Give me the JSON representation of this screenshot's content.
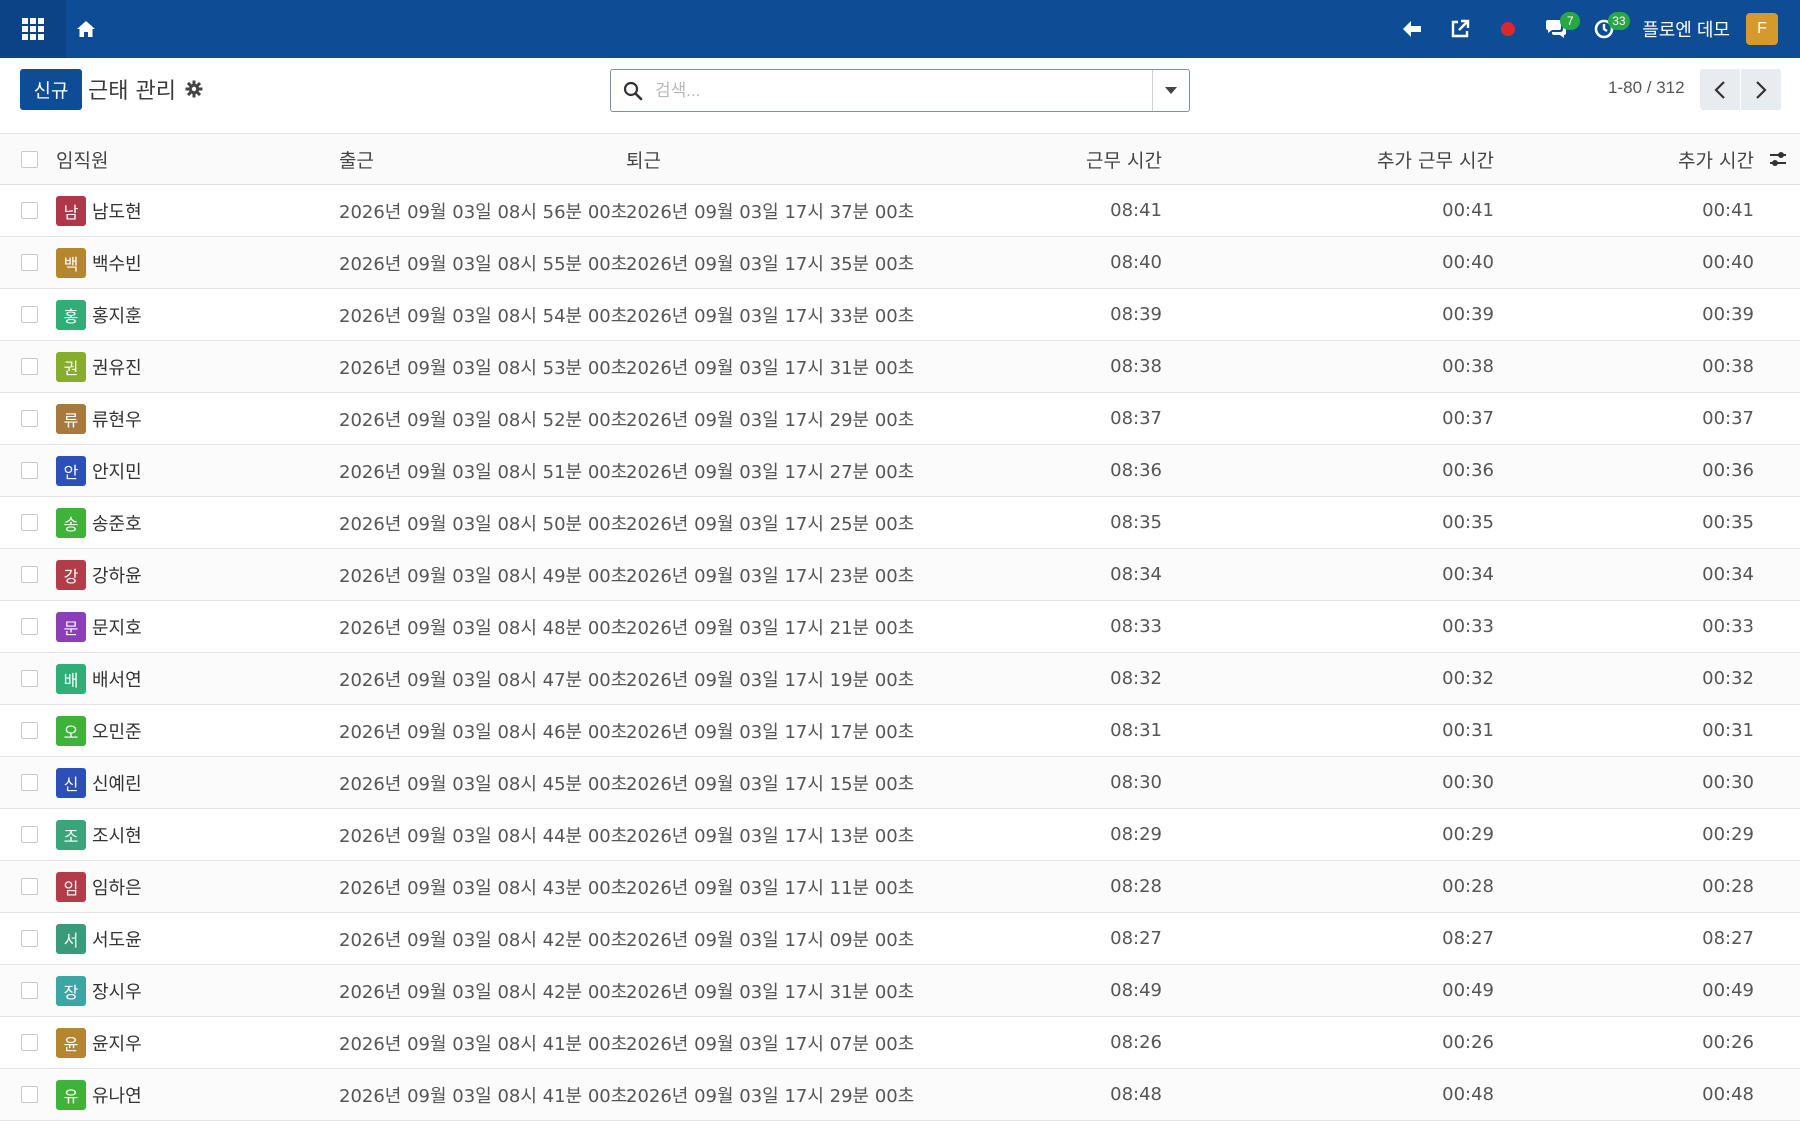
{
  "navbar": {
    "user_name": "플로엔 데모",
    "user_initial": "F",
    "messages_count": "7",
    "activities_count": "33"
  },
  "control": {
    "new_label": "신규",
    "title": "근태 관리",
    "search_placeholder": "검색...",
    "pager_value": "1-80 / 312"
  },
  "columns": {
    "employee": "임직원",
    "check_in": "출근",
    "check_out": "퇴근",
    "worked_hours": "근무 시간",
    "extra_hours": "추가 근무 시간",
    "added_hours": "추가 시간"
  },
  "rows": [
    {
      "initial": "남",
      "name": "남도현",
      "color": "#b0364a",
      "check_in": "2026년 09월 03일 08시 56분 00초",
      "check_out": "2026년 09월 03일 17시 37분 00초",
      "worked": "08:41",
      "extra": "00:41",
      "added": "00:41"
    },
    {
      "initial": "백",
      "name": "백수빈",
      "color": "#b5862e",
      "check_in": "2026년 09월 03일 08시 55분 00초",
      "check_out": "2026년 09월 03일 17시 35분 00초",
      "worked": "08:40",
      "extra": "00:40",
      "added": "00:40"
    },
    {
      "initial": "홍",
      "name": "홍지훈",
      "color": "#2fae76",
      "check_in": "2026년 09월 03일 08시 54분 00초",
      "check_out": "2026년 09월 03일 17시 33분 00초",
      "worked": "08:39",
      "extra": "00:39",
      "added": "00:39"
    },
    {
      "initial": "권",
      "name": "권유진",
      "color": "#86ad2c",
      "check_in": "2026년 09월 03일 08시 53분 00초",
      "check_out": "2026년 09월 03일 17시 31분 00초",
      "worked": "08:38",
      "extra": "00:38",
      "added": "00:38"
    },
    {
      "initial": "류",
      "name": "류현우",
      "color": "#a8793f",
      "check_in": "2026년 09월 03일 08시 52분 00초",
      "check_out": "2026년 09월 03일 17시 29분 00초",
      "worked": "08:37",
      "extra": "00:37",
      "added": "00:37"
    },
    {
      "initial": "안",
      "name": "안지민",
      "color": "#2d4fb8",
      "check_in": "2026년 09월 03일 08시 51분 00초",
      "check_out": "2026년 09월 03일 17시 27분 00초",
      "worked": "08:36",
      "extra": "00:36",
      "added": "00:36"
    },
    {
      "initial": "송",
      "name": "송준호",
      "color": "#3fb23a",
      "check_in": "2026년 09월 03일 08시 50분 00초",
      "check_out": "2026년 09월 03일 17시 25분 00초",
      "worked": "08:35",
      "extra": "00:35",
      "added": "00:35"
    },
    {
      "initial": "강",
      "name": "강하윤",
      "color": "#b23c4a",
      "check_in": "2026년 09월 03일 08시 49분 00초",
      "check_out": "2026년 09월 03일 17시 23분 00초",
      "worked": "08:34",
      "extra": "00:34",
      "added": "00:34"
    },
    {
      "initial": "문",
      "name": "문지호",
      "color": "#8b3fb6",
      "check_in": "2026년 09월 03일 08시 48분 00초",
      "check_out": "2026년 09월 03일 17시 21분 00초",
      "worked": "08:33",
      "extra": "00:33",
      "added": "00:33"
    },
    {
      "initial": "배",
      "name": "배서연",
      "color": "#2fae76",
      "check_in": "2026년 09월 03일 08시 47분 00초",
      "check_out": "2026년 09월 03일 17시 19분 00초",
      "worked": "08:32",
      "extra": "00:32",
      "added": "00:32"
    },
    {
      "initial": "오",
      "name": "오민준",
      "color": "#3fb23a",
      "check_in": "2026년 09월 03일 08시 46분 00초",
      "check_out": "2026년 09월 03일 17시 17분 00초",
      "worked": "08:31",
      "extra": "00:31",
      "added": "00:31"
    },
    {
      "initial": "신",
      "name": "신예린",
      "color": "#2d4fb8",
      "check_in": "2026년 09월 03일 08시 45분 00초",
      "check_out": "2026년 09월 03일 17시 15분 00초",
      "worked": "08:30",
      "extra": "00:30",
      "added": "00:30"
    },
    {
      "initial": "조",
      "name": "조시현",
      "color": "#3aa47a",
      "check_in": "2026년 09월 03일 08시 44분 00초",
      "check_out": "2026년 09월 03일 17시 13분 00초",
      "worked": "08:29",
      "extra": "00:29",
      "added": "00:29"
    },
    {
      "initial": "임",
      "name": "임하은",
      "color": "#b23c4a",
      "check_in": "2026년 09월 03일 08시 43분 00초",
      "check_out": "2026년 09월 03일 17시 11분 00초",
      "worked": "08:28",
      "extra": "00:28",
      "added": "00:28"
    },
    {
      "initial": "서",
      "name": "서도윤",
      "color": "#3a9b7a",
      "check_in": "2026년 09월 03일 08시 42분 00초",
      "check_out": "2026년 09월 03일 17시 09분 00초",
      "worked": "08:27",
      "extra": "08:27",
      "added": "08:27"
    },
    {
      "initial": "장",
      "name": "장시우",
      "color": "#3aa7a4",
      "check_in": "2026년 09월 03일 08시 42분 00초",
      "check_out": "2026년 09월 03일 17시 31분 00초",
      "worked": "08:49",
      "extra": "00:49",
      "added": "00:49"
    },
    {
      "initial": "윤",
      "name": "윤지우",
      "color": "#b5862e",
      "check_in": "2026년 09월 03일 08시 41분 00초",
      "check_out": "2026년 09월 03일 17시 07분 00초",
      "worked": "08:26",
      "extra": "00:26",
      "added": "00:26"
    },
    {
      "initial": "유",
      "name": "유나연",
      "color": "#3fb23a",
      "check_in": "2026년 09월 03일 08시 41분 00초",
      "check_out": "2026년 09월 03일 17시 29분 00초",
      "worked": "08:48",
      "extra": "00:48",
      "added": "00:48"
    }
  ]
}
